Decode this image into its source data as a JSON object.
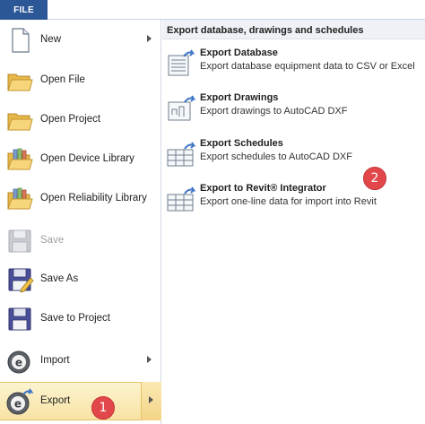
{
  "file_tab": "FILE",
  "menu": [
    {
      "label": "New",
      "icon": "new-document-icon",
      "submenu": true
    },
    {
      "label": "Open File",
      "icon": "folder-open-icon",
      "submenu": false
    },
    {
      "label": "Open Project",
      "icon": "folder-open-icon",
      "submenu": false
    },
    {
      "label": "Open Device Library",
      "icon": "folder-library-icon",
      "submenu": false
    },
    {
      "label": "Open Reliability Library",
      "icon": "folder-library-icon",
      "submenu": false
    },
    {
      "label": "Save",
      "icon": "floppy-disk-icon",
      "submenu": false,
      "disabled": true
    },
    {
      "label": "Save As",
      "icon": "floppy-save-as-icon",
      "submenu": false
    },
    {
      "label": "Save to Project",
      "icon": "floppy-disk-icon",
      "submenu": false
    },
    {
      "label": "Import",
      "icon": "etap-import-icon",
      "submenu": true
    },
    {
      "label": "Export",
      "icon": "etap-export-icon",
      "submenu": true,
      "selected": true
    }
  ],
  "panel": {
    "header": "Export database, drawings and schedules",
    "items": [
      {
        "title": "Export Database",
        "desc": "Export database equipment data to CSV or Excel",
        "icon": "export-database-icon"
      },
      {
        "title": "Export Drawings",
        "desc": "Export drawings to AutoCAD DXF",
        "icon": "export-drawings-icon"
      },
      {
        "title": "Export Schedules",
        "desc": "Export schedules to AutoCAD DXF",
        "icon": "export-schedules-icon"
      },
      {
        "title": "Export to Revit® Integrator",
        "desc": "Export one-line data for import into Revit",
        "icon": "export-revit-icon"
      }
    ]
  },
  "badges": [
    "1",
    "2"
  ]
}
